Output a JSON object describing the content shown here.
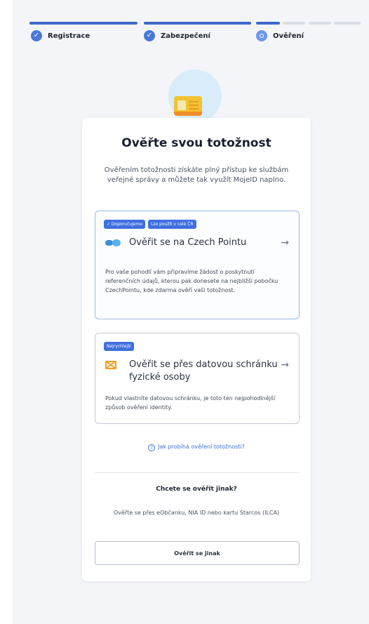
{
  "stepper": {
    "steps": [
      {
        "label": "Registrace",
        "state": "done"
      },
      {
        "label": "Zabezpečení",
        "state": "done"
      },
      {
        "label": "Ověření",
        "state": "current"
      }
    ]
  },
  "main": {
    "title": "Ověřte svou totožnost",
    "lead": "Ověřením totožnosti získáte plný přístup ke službám veřejné správy a můžete tak využít MojeID naplno.",
    "options": [
      {
        "badges": [
          "✓ Doporučujeme",
          "Lze použít v celé ČR"
        ],
        "title": "Ověřit se na Czech Pointu",
        "icon": "czech-point-icon",
        "arrow": "→",
        "description": "Pro vaše pohodlí vám připravíme žádost o poskytnutí referenčních údajů, kterou pak donesete na nejbližší pobočku CzechPointu, kde zdarma ověří vaši totožnost."
      },
      {
        "badges": [
          "Nejrychlejší"
        ],
        "title": "Ověřit se přes datovou schránku fyzické osoby",
        "icon": "data-box-icon",
        "arrow": "→",
        "description": "Pokud vlastníte datovou schránku, je toto ten nejpohodlnější způsob ověření identity."
      }
    ],
    "help_link": "Jak probíhá ověření totožnosti?",
    "alternative": {
      "title": "Chcete se ověřit jinak?",
      "description": "Ověřte se přes eObčanku, NIA ID nebo kartu Starcos (ILCA)",
      "button": "Ověřit se jinak"
    }
  },
  "colors": {
    "accent": "#3f68c8",
    "badge": "#3f6fe0",
    "link": "#3a6fd8"
  }
}
